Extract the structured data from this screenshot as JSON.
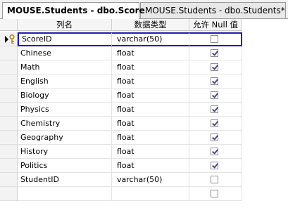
{
  "tabs": [
    {
      "label": "MOUSE.Students - dbo.Score",
      "active": true
    },
    {
      "label": "MOUSE.Students - dbo.Students*",
      "active": false
    }
  ],
  "columns": {
    "name": "列名",
    "type": "数据类型",
    "nullable": "允许 Null 值"
  },
  "rows": [
    {
      "name": "ScoreID",
      "type": "varchar(50)",
      "allow_null": false,
      "primary_key": true,
      "current": true
    },
    {
      "name": "Chinese",
      "type": "float",
      "allow_null": true
    },
    {
      "name": "Math",
      "type": "float",
      "allow_null": true
    },
    {
      "name": "English",
      "type": "float",
      "allow_null": true
    },
    {
      "name": "Biology",
      "type": "float",
      "allow_null": true
    },
    {
      "name": "Physics",
      "type": "float",
      "allow_null": true
    },
    {
      "name": "Chemistry",
      "type": "float",
      "allow_null": true
    },
    {
      "name": "Geography",
      "type": "float",
      "allow_null": true
    },
    {
      "name": "History",
      "type": "float",
      "allow_null": true
    },
    {
      "name": "Politics",
      "type": "float",
      "allow_null": true
    },
    {
      "name": "StudentID",
      "type": "varchar(50)",
      "allow_null": false
    },
    {
      "name": "",
      "type": "",
      "allow_null": false
    }
  ],
  "colors": {
    "selection_border": "#2020b0",
    "tab_bg": "#f1f1f1",
    "header_bg": "#f5f5f5"
  },
  "icons": {
    "row_pointer": "row-pointer-icon",
    "primary_key": "primary-key-icon"
  }
}
